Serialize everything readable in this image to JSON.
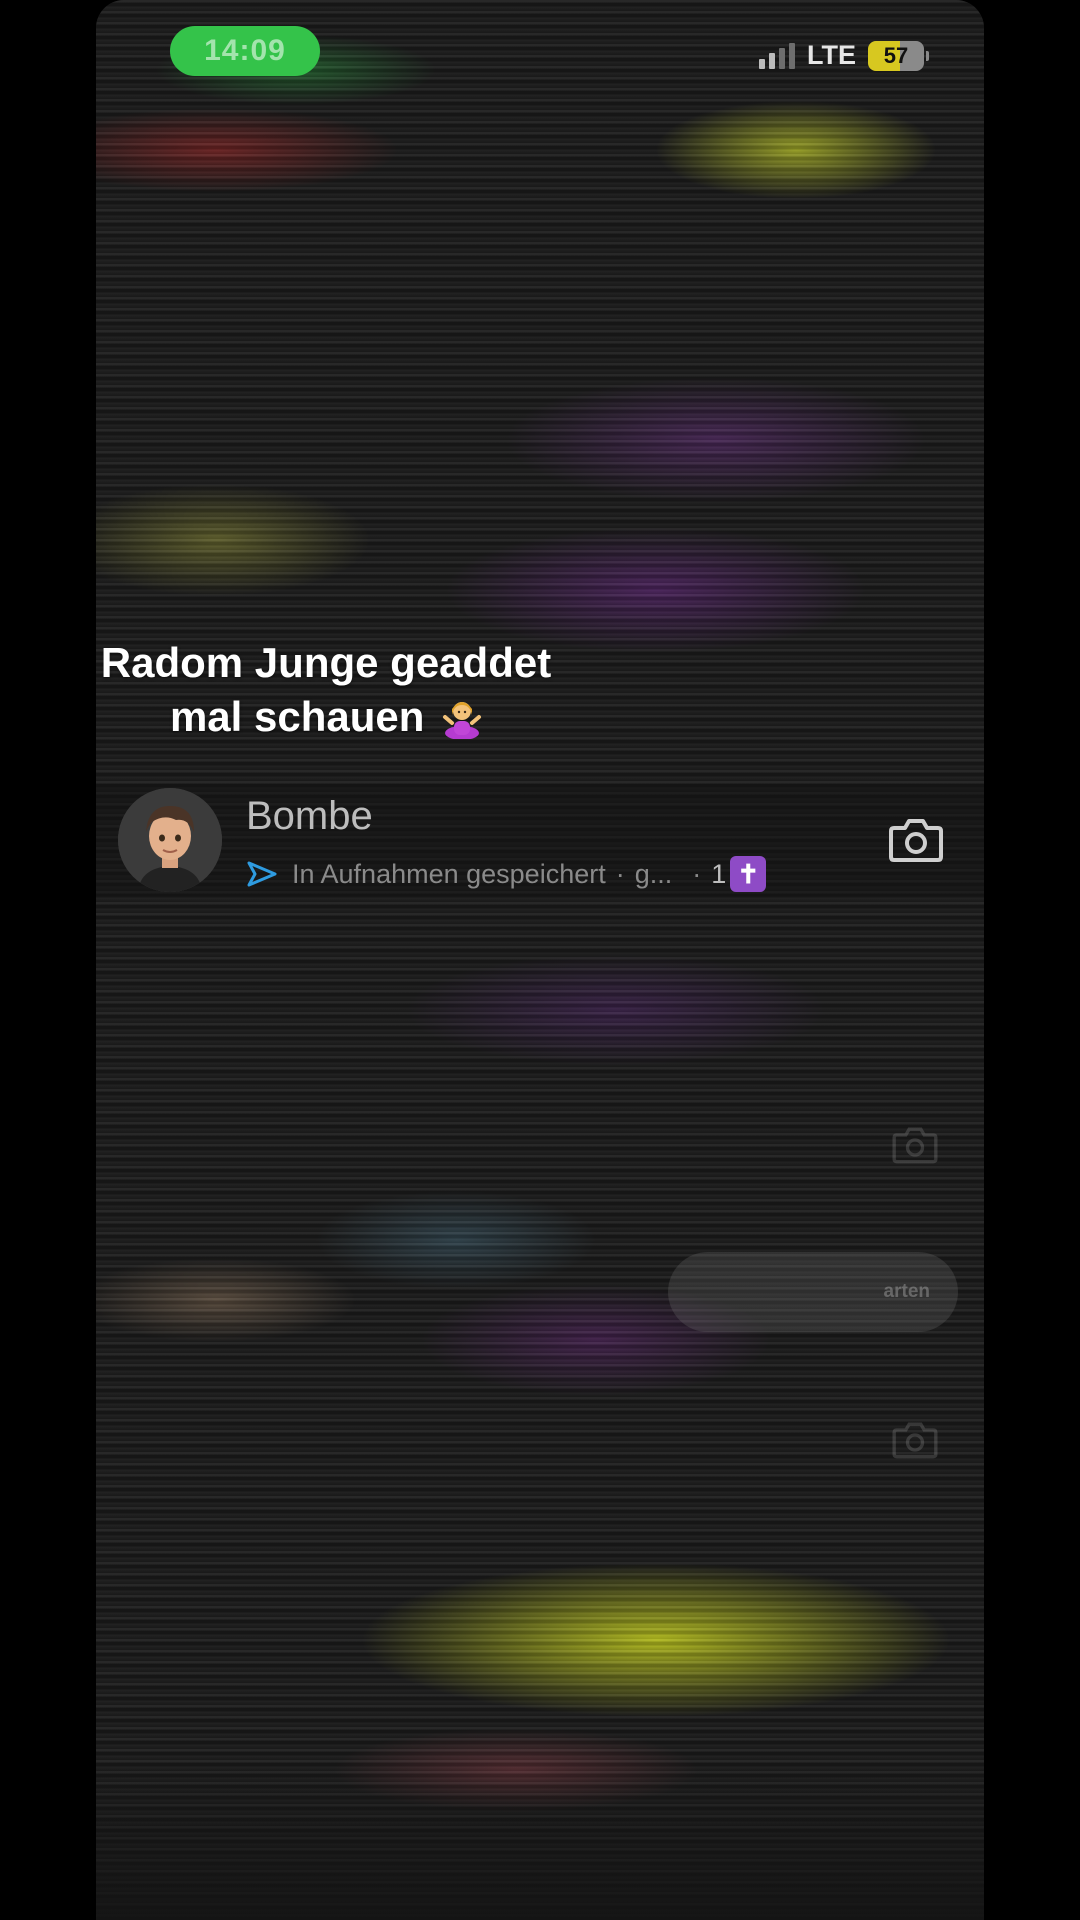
{
  "status_bar": {
    "time": "14:09",
    "network": "LTE",
    "battery_level": "57",
    "signal_icon": "cellular-signal-icon"
  },
  "caption": {
    "line1": "Radom Junge geaddet",
    "line2": "mal schauen",
    "emoji": "person-shrugging-emoji"
  },
  "chat": {
    "name": "Bombe",
    "status_icon": "send-arrow-icon",
    "status_text": "In Aufnahmen gespeichert",
    "separator": "·",
    "truncated": "g...",
    "streak_count": "1",
    "streak_emoji": "✝",
    "action_icon": "camera-icon"
  },
  "ghost": {
    "pill_label": "arten"
  },
  "colors": {
    "time_pill": "#34c34a",
    "battery": "#d7c820",
    "send_icon": "#2e9be0",
    "streak_badge": "#8e4bc6"
  }
}
